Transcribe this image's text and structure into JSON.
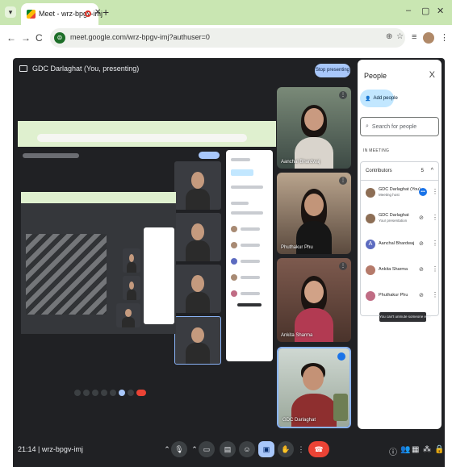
{
  "browser": {
    "tab_title": "Meet - wrz-bpgv-imj",
    "close": "✕",
    "new_tab": "+",
    "url": "meet.google.com/wrz-bpgv-imj?authuser=0",
    "window_controls": [
      "–",
      "▢",
      "✕"
    ]
  },
  "meet": {
    "presenting_label": "GDC Darlaghat (You, presenting)",
    "stop_presenting": "Stop presenting",
    "time_code": "21:14  |  wrz-bpgv-imj"
  },
  "tiles": [
    {
      "name": "Aanchal Bhardwaj",
      "icon": "more-vert-icon"
    },
    {
      "name": "Phuthakur Phu",
      "icon": "more-vert-icon"
    },
    {
      "name": "Ankita Sharma",
      "icon": "more-vert-icon"
    },
    {
      "name": "GDC Darlaghat",
      "icon": "more-vert-icon"
    }
  ],
  "people_panel": {
    "title": "People",
    "close": "X",
    "add_people": "Add people",
    "search_placeholder": "Search for people",
    "in_meeting_label": "IN MEETING",
    "contributors_label": "Contributors",
    "contributors_count": "5",
    "participants": [
      {
        "name": "GDC Darlaghat (You)",
        "sub": "Meeting host",
        "avatar_color": "#8d6e55",
        "icon": "speaking-icon"
      },
      {
        "name": "GDC Darlaghat",
        "sub": "Your presentation",
        "avatar_color": "#8d6e55",
        "icon": "mic-off-icon"
      },
      {
        "name": "Aanchal Bhardwaj",
        "sub": "",
        "avatar_color": "#5c6bc0",
        "avatar_letter": "A",
        "icon": "mic-off-icon"
      },
      {
        "name": "Ankita Sharma",
        "sub": "",
        "avatar_color": "#b57a6a",
        "icon": "mic-off-icon"
      },
      {
        "name": "Phuthakur Phu",
        "sub": "",
        "avatar_color": "#c06c84",
        "icon": "mic-off-icon"
      }
    ],
    "tooltip": "You can't unmute someone else"
  },
  "colors": {
    "tabstrip": "#c9e6b2",
    "meet_bg": "#202124",
    "accent_blue": "#a8c7fa",
    "end_call_red": "#ea4335"
  }
}
